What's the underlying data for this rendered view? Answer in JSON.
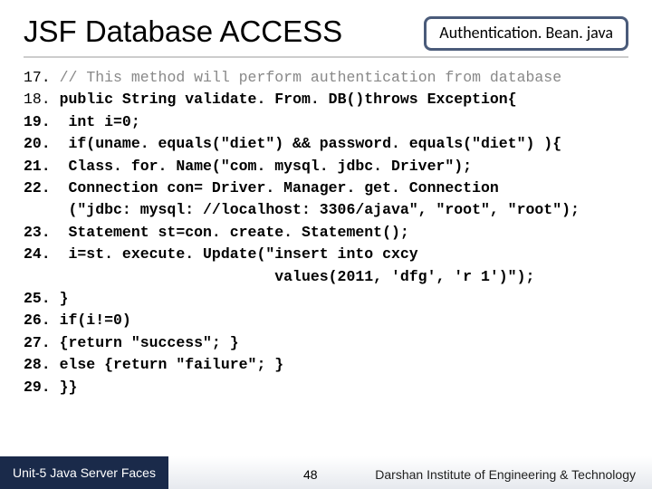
{
  "header": {
    "title": "JSF Database ACCESS",
    "filename": "Authentication. Bean. java"
  },
  "code": {
    "l17a": "17.",
    "l17b": "// This method will perform authentication from database",
    "l18a": "18.",
    "l18b": "public String validate. From. DB()throws Exception{",
    "l19": "19.  int i=0;",
    "l20": "20.  if(uname. equals(\"diet\") && password. equals(\"diet\") ){",
    "l21": "21.  Class. for. Name(\"com. mysql. jdbc. Driver\");",
    "l22a": "22.  Connection con= Driver. Manager. get. Connection",
    "l22b": "     (\"jdbc: mysql: //localhost: 3306/ajava\", \"root\", \"root\");",
    "l23": "23.  Statement st=con. create. Statement();",
    "l24a": "24.  i=st. execute. Update(",
    "l24b": "\"insert into cxcy",
    "l24c": "                            values(2011, 'dfg', 'r 1')\"",
    "l24d": ");",
    "l25": "25. }",
    "l26": "26. if(i!=0)",
    "l27": "27. {return \"success\"; }",
    "l28": "28. else {return \"failure\"; }",
    "l29": "29. }}"
  },
  "footer": {
    "left": "Unit-5 Java Server Faces",
    "page": "48",
    "right": "Darshan Institute of Engineering & Technology"
  }
}
